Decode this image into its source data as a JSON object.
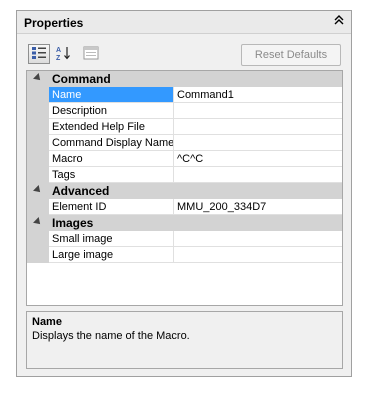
{
  "panel": {
    "title": "Properties",
    "collapse_icon": "double-chevron-up-icon"
  },
  "toolbar": {
    "categorized_icon": "categorized-view-icon",
    "alphabetical_icon": "sort-az-icon",
    "property_pages_icon": "property-pages-icon",
    "reset_label": "Reset Defaults"
  },
  "categories": [
    {
      "label": "Command",
      "properties": [
        {
          "name": "Name",
          "value": "Command1",
          "selected": true
        },
        {
          "name": "Description",
          "value": ""
        },
        {
          "name": "Extended Help File",
          "value": ""
        },
        {
          "name": "Command Display Name",
          "value": ""
        },
        {
          "name": "Macro",
          "value": "^C^C"
        },
        {
          "name": "Tags",
          "value": ""
        }
      ]
    },
    {
      "label": "Advanced",
      "properties": [
        {
          "name": "Element ID",
          "value": "MMU_200_334D7"
        }
      ]
    },
    {
      "label": "Images",
      "properties": [
        {
          "name": "Small image",
          "value": ""
        },
        {
          "name": "Large image",
          "value": ""
        }
      ]
    }
  ],
  "description": {
    "title": "Name",
    "text": "Displays the name of the Macro."
  },
  "colors": {
    "selection": "#3399ff",
    "category_band": "#d3d3d3",
    "panel_bg": "#f0f0f0"
  }
}
